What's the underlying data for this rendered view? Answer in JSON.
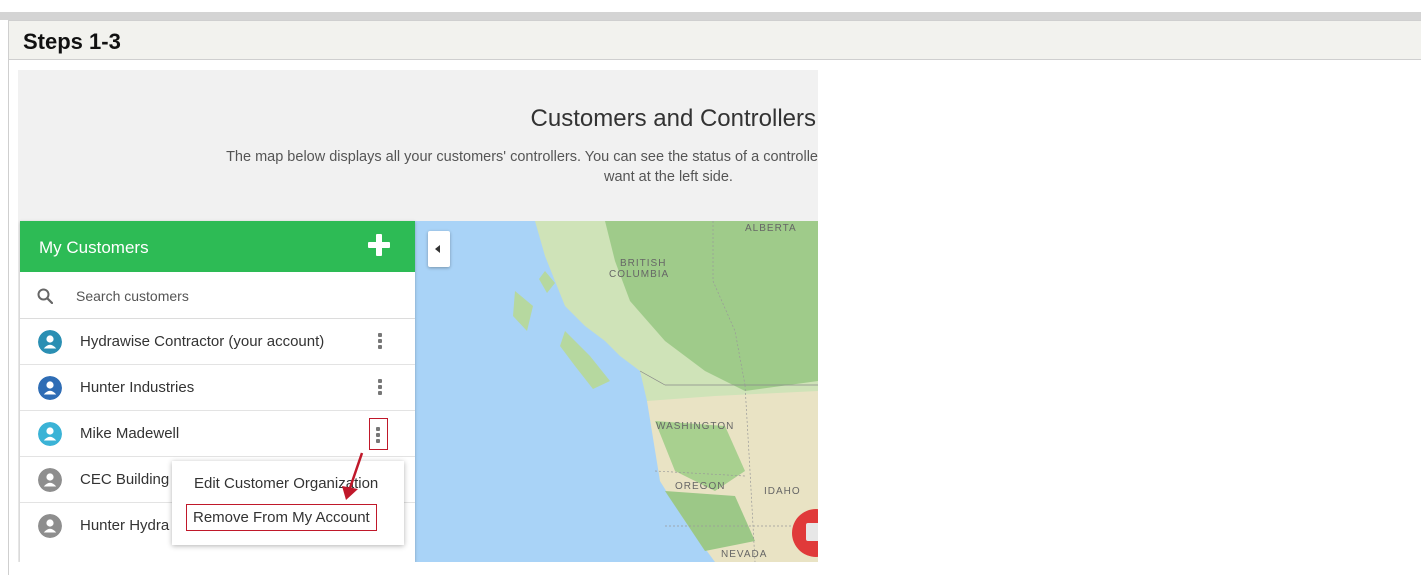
{
  "header": {
    "title": "Steps 1-3"
  },
  "page": {
    "title": "Customers and Controllers",
    "description_line1": "The map below displays all your customers' controllers. You can see the status of a controlle",
    "description_line2": "want at the left side."
  },
  "panel": {
    "title": "My Customers",
    "search_placeholder": "Search customers",
    "customers": [
      {
        "name": "Hydrawise Contractor (your account)",
        "avatar_color": "#2b8fb3"
      },
      {
        "name": "Hunter Industries",
        "avatar_color": "#2f6db5"
      },
      {
        "name": "Mike Madewell",
        "avatar_color": "#3bb3d6"
      },
      {
        "name": "CEC Building",
        "avatar_color": "#8e8e8e"
      },
      {
        "name": "Hunter Hydra",
        "avatar_color": "#8e8e8e"
      }
    ]
  },
  "context_menu": {
    "edit_label": "Edit Customer Organization",
    "remove_label": "Remove From My Account"
  },
  "map": {
    "labels": [
      "ALBERTA",
      "BRITISH",
      "COLUMBIA",
      "WASHINGTON",
      "OREGON",
      "IDAHO",
      "NEVADA"
    ]
  },
  "colors": {
    "panel_header": "#2dbb55",
    "highlight": "#c0182a",
    "water": "#a9d3f7"
  }
}
